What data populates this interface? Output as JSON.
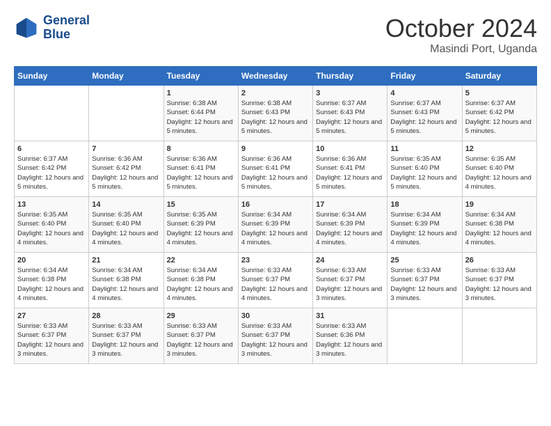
{
  "header": {
    "logo_line1": "General",
    "logo_line2": "Blue",
    "month": "October 2024",
    "location": "Masindi Port, Uganda"
  },
  "weekdays": [
    "Sunday",
    "Monday",
    "Tuesday",
    "Wednesday",
    "Thursday",
    "Friday",
    "Saturday"
  ],
  "weeks": [
    [
      {
        "day": "",
        "info": ""
      },
      {
        "day": "",
        "info": ""
      },
      {
        "day": "1",
        "info": "Sunrise: 6:38 AM\nSunset: 6:44 PM\nDaylight: 12 hours and 5 minutes."
      },
      {
        "day": "2",
        "info": "Sunrise: 6:38 AM\nSunset: 6:43 PM\nDaylight: 12 hours and 5 minutes."
      },
      {
        "day": "3",
        "info": "Sunrise: 6:37 AM\nSunset: 6:43 PM\nDaylight: 12 hours and 5 minutes."
      },
      {
        "day": "4",
        "info": "Sunrise: 6:37 AM\nSunset: 6:43 PM\nDaylight: 12 hours and 5 minutes."
      },
      {
        "day": "5",
        "info": "Sunrise: 6:37 AM\nSunset: 6:42 PM\nDaylight: 12 hours and 5 minutes."
      }
    ],
    [
      {
        "day": "6",
        "info": "Sunrise: 6:37 AM\nSunset: 6:42 PM\nDaylight: 12 hours and 5 minutes."
      },
      {
        "day": "7",
        "info": "Sunrise: 6:36 AM\nSunset: 6:42 PM\nDaylight: 12 hours and 5 minutes."
      },
      {
        "day": "8",
        "info": "Sunrise: 6:36 AM\nSunset: 6:41 PM\nDaylight: 12 hours and 5 minutes."
      },
      {
        "day": "9",
        "info": "Sunrise: 6:36 AM\nSunset: 6:41 PM\nDaylight: 12 hours and 5 minutes."
      },
      {
        "day": "10",
        "info": "Sunrise: 6:36 AM\nSunset: 6:41 PM\nDaylight: 12 hours and 5 minutes."
      },
      {
        "day": "11",
        "info": "Sunrise: 6:35 AM\nSunset: 6:40 PM\nDaylight: 12 hours and 5 minutes."
      },
      {
        "day": "12",
        "info": "Sunrise: 6:35 AM\nSunset: 6:40 PM\nDaylight: 12 hours and 4 minutes."
      }
    ],
    [
      {
        "day": "13",
        "info": "Sunrise: 6:35 AM\nSunset: 6:40 PM\nDaylight: 12 hours and 4 minutes."
      },
      {
        "day": "14",
        "info": "Sunrise: 6:35 AM\nSunset: 6:40 PM\nDaylight: 12 hours and 4 minutes."
      },
      {
        "day": "15",
        "info": "Sunrise: 6:35 AM\nSunset: 6:39 PM\nDaylight: 12 hours and 4 minutes."
      },
      {
        "day": "16",
        "info": "Sunrise: 6:34 AM\nSunset: 6:39 PM\nDaylight: 12 hours and 4 minutes."
      },
      {
        "day": "17",
        "info": "Sunrise: 6:34 AM\nSunset: 6:39 PM\nDaylight: 12 hours and 4 minutes."
      },
      {
        "day": "18",
        "info": "Sunrise: 6:34 AM\nSunset: 6:39 PM\nDaylight: 12 hours and 4 minutes."
      },
      {
        "day": "19",
        "info": "Sunrise: 6:34 AM\nSunset: 6:38 PM\nDaylight: 12 hours and 4 minutes."
      }
    ],
    [
      {
        "day": "20",
        "info": "Sunrise: 6:34 AM\nSunset: 6:38 PM\nDaylight: 12 hours and 4 minutes."
      },
      {
        "day": "21",
        "info": "Sunrise: 6:34 AM\nSunset: 6:38 PM\nDaylight: 12 hours and 4 minutes."
      },
      {
        "day": "22",
        "info": "Sunrise: 6:34 AM\nSunset: 6:38 PM\nDaylight: 12 hours and 4 minutes."
      },
      {
        "day": "23",
        "info": "Sunrise: 6:33 AM\nSunset: 6:37 PM\nDaylight: 12 hours and 4 minutes."
      },
      {
        "day": "24",
        "info": "Sunrise: 6:33 AM\nSunset: 6:37 PM\nDaylight: 12 hours and 3 minutes."
      },
      {
        "day": "25",
        "info": "Sunrise: 6:33 AM\nSunset: 6:37 PM\nDaylight: 12 hours and 3 minutes."
      },
      {
        "day": "26",
        "info": "Sunrise: 6:33 AM\nSunset: 6:37 PM\nDaylight: 12 hours and 3 minutes."
      }
    ],
    [
      {
        "day": "27",
        "info": "Sunrise: 6:33 AM\nSunset: 6:37 PM\nDaylight: 12 hours and 3 minutes."
      },
      {
        "day": "28",
        "info": "Sunrise: 6:33 AM\nSunset: 6:37 PM\nDaylight: 12 hours and 3 minutes."
      },
      {
        "day": "29",
        "info": "Sunrise: 6:33 AM\nSunset: 6:37 PM\nDaylight: 12 hours and 3 minutes."
      },
      {
        "day": "30",
        "info": "Sunrise: 6:33 AM\nSunset: 6:37 PM\nDaylight: 12 hours and 3 minutes."
      },
      {
        "day": "31",
        "info": "Sunrise: 6:33 AM\nSunset: 6:36 PM\nDaylight: 12 hours and 3 minutes."
      },
      {
        "day": "",
        "info": ""
      },
      {
        "day": "",
        "info": ""
      }
    ]
  ]
}
